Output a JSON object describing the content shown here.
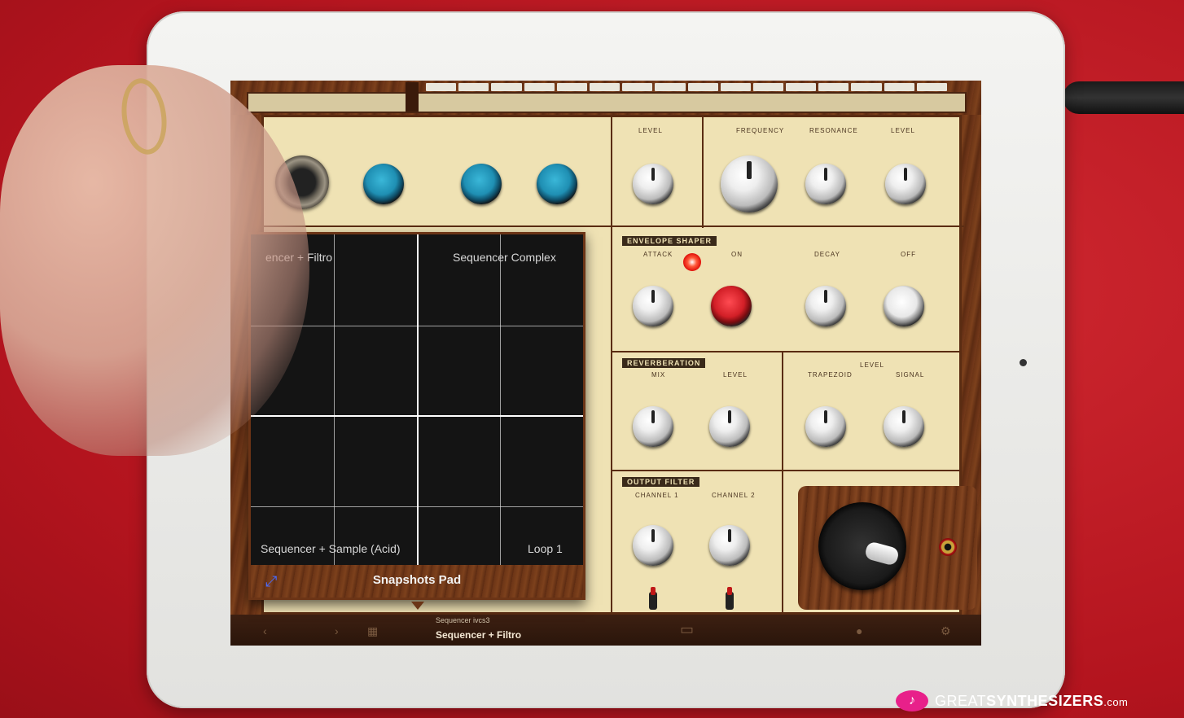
{
  "sections": {
    "envelope_shaper": "ENVELOPE SHAPER",
    "reverberation": "REVERBERATION",
    "output_filter": "OUTPUT FILTER"
  },
  "labels": {
    "osc_level_top": "LEVEL",
    "frequency": "FREQUENCY",
    "resonance": "RESONANCE",
    "level": "LEVEL",
    "attack": "ATTACK",
    "on": "ON",
    "decay": "DECAY",
    "off": "OFF",
    "mix": "MIX",
    "rev_level": "LEVEL",
    "level_group": "LEVEL",
    "trapezoid": "TRAPEZOID",
    "signal": "SIGNAL",
    "channel1": "CHANNEL 1",
    "channel2": "CHANNEL 2"
  },
  "snapshots_pad": {
    "title": "Snapshots Pad",
    "corner_top_left": "encer + Filtro",
    "corner_top_right": "Sequencer Complex",
    "corner_bottom_left": "Sequencer + Sample (Acid)",
    "corner_bottom_right": "Loop 1"
  },
  "snapshot_status": {
    "sub": "Sequencer ivcs3",
    "main": "Sequencer + Filtro"
  },
  "watermark": {
    "great": "GREAT",
    "synth": "SYNTHESIZERS",
    "domain": ".com"
  },
  "colors": {
    "panel": "#efe2b4",
    "wood": "#6b3416",
    "knob_accent_blue": "#1f8fb3",
    "knob_accent_red": "#d21f27",
    "brand_pink": "#e8208a"
  }
}
